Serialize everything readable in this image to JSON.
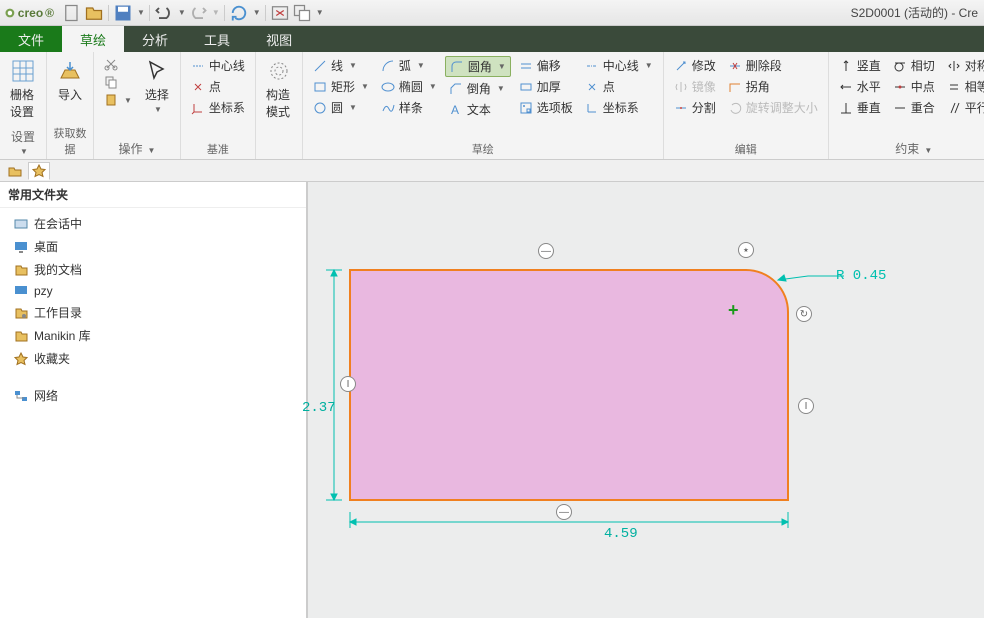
{
  "app": {
    "logo": "creo",
    "title": "S2D0001 (活动的) - Cre"
  },
  "menu": {
    "file": "文件",
    "sketch": "草绘",
    "analysis": "分析",
    "tools": "工具",
    "view": "视图"
  },
  "ribbon": {
    "grid": {
      "label": "栅格设置",
      "set": "设置"
    },
    "import": {
      "label": "导入",
      "data": "获取数据"
    },
    "select": {
      "label": "选择",
      "ops": "操作"
    },
    "datum": {
      "centerline": "中心线",
      "point": "点",
      "csys": "坐标系",
      "label": "基准"
    },
    "construct": {
      "label": "构造模式"
    },
    "sketch": {
      "line": "线",
      "arc": "弧",
      "fillet": "圆角",
      "offset": "偏移",
      "centerline": "中心线",
      "rect": "矩形",
      "ellipse": "椭圆",
      "chamfer": "倒角",
      "thicken": "加厚",
      "point": "点",
      "circle": "圆",
      "spline": "样条",
      "text": "文本",
      "palette": "选项板",
      "csys": "坐标系",
      "label": "草绘"
    },
    "edit": {
      "modify": "修改",
      "delseg": "删除段",
      "mirror": "镜像",
      "corner": "拐角",
      "divide": "分割",
      "rotresize": "旋转调整大小",
      "label": "编辑"
    },
    "constrain": {
      "vert": "竖直",
      "tan": "相切",
      "sym": "对称",
      "horiz": "水平",
      "mid": "中点",
      "equal": "相等",
      "perp": "垂直",
      "coinc": "重合",
      "parallel": "平行",
      "label": "约束"
    }
  },
  "sidebar": {
    "header": "常用文件夹",
    "items": [
      {
        "label": "在会话中",
        "icon": "session"
      },
      {
        "label": "桌面",
        "icon": "desktop"
      },
      {
        "label": "我的文档",
        "icon": "docs"
      },
      {
        "label": "pzy",
        "icon": "user"
      },
      {
        "label": "工作目录",
        "icon": "workdir"
      },
      {
        "label": "Manikin 库",
        "icon": "lib"
      },
      {
        "label": "收藏夹",
        "icon": "fav"
      }
    ],
    "network": "网络"
  },
  "chart_data": {
    "type": "diagram",
    "shape": "rectangle-with-fillet",
    "width": 4.59,
    "height": 2.37,
    "fillet_radius": 0.45,
    "fillet_label": "R 0.45",
    "fill": "#e9b8e0",
    "stroke": "#f08020"
  }
}
